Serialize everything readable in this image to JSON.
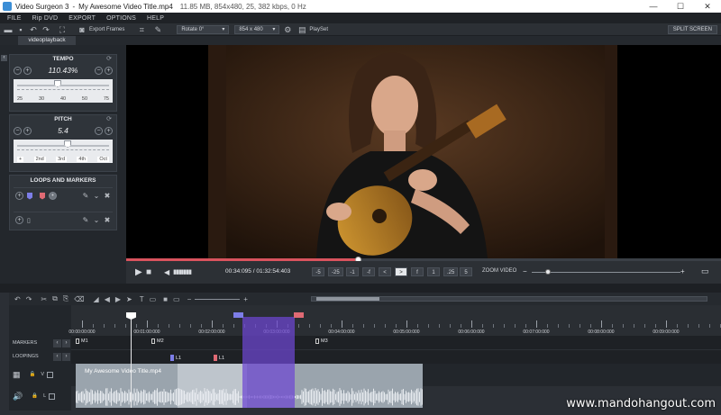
{
  "window": {
    "app": "Video Surgeon 3",
    "separator": "-",
    "file": "My Awesome Video Title.mp4",
    "info": "11.85 MB, 854x480, 25, 382 kbps, 0 Hz"
  },
  "menu": [
    "FILE",
    "Rip DVD",
    "EXPORT",
    "OPTIONS",
    "HELP"
  ],
  "toolbar": {
    "export_label": "Export Frames",
    "rotate_value": "Rotate 0°",
    "resolution_value": "854 x 480",
    "playset_label": "PlaySet",
    "split_label": "SPLIT SCREEN"
  },
  "tab": "videoplayback",
  "tempo": {
    "title": "TEMPO",
    "value": "110.43%",
    "ticks": [
      "25",
      "30",
      "40",
      "50",
      "75"
    ],
    "level": 0.44
  },
  "pitch": {
    "title": "PITCH",
    "value": "5.4",
    "ticks": [
      "+",
      "2nd",
      "3rd",
      "4th",
      "Oct"
    ],
    "level": 0.55
  },
  "loops_markers": {
    "title": "LOOPS AND MARKERS"
  },
  "transport": {
    "timecode": "00:34:095 / 01:32:54:403",
    "speeds": [
      "-5",
      "-25",
      "-1",
      "-f",
      "<",
      ">",
      "f",
      "1",
      ".25",
      "5"
    ],
    "active_speed_index": 5,
    "zoom_label": "ZOOM VIDEO",
    "progress": 0.39
  },
  "timeline": {
    "ruler": [
      "00:00:00:000",
      "00:01:00:000",
      "00:02:00:000",
      "00:03:00:000",
      "00:04:00:000",
      "00:05:00:000",
      "00:06:00:000",
      "00:07:00:000",
      "00:08:00:000",
      "00:09:00:000"
    ],
    "markers_label": "MARKERS",
    "loopings_label": "LOOPINGS",
    "markers": [
      "M1",
      "M2",
      "M3"
    ],
    "loops": [
      "L1",
      "L1"
    ],
    "clip_title": "My Awesome Video Title.mp4",
    "video_track": "V",
    "audio_track": "L"
  },
  "colors": {
    "accent_red": "#d9535e",
    "selection_purple": "#6e46d2",
    "marker_blue": "#7d7ee8",
    "marker_red": "#e06a74"
  },
  "watermark": "www.mandohangout.com"
}
